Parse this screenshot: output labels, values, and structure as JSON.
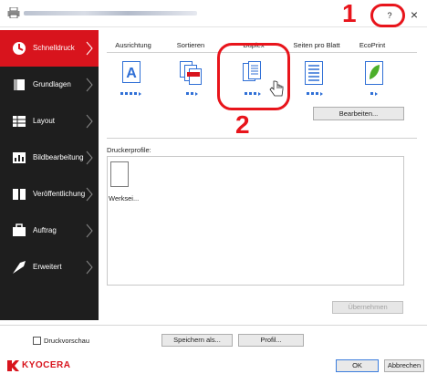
{
  "titlebar": {
    "help_label": "?",
    "close_label": "×"
  },
  "annotations": {
    "marker_1": "1",
    "marker_2": "2"
  },
  "sidebar": {
    "items": [
      {
        "label": "Schnelldruck",
        "icon": "quick-print-icon",
        "active": true
      },
      {
        "label": "Grundlagen",
        "icon": "basics-icon",
        "active": false
      },
      {
        "label": "Layout",
        "icon": "layout-icon",
        "active": false
      },
      {
        "label": "Bildbearbeitung",
        "icon": "image-edit-icon",
        "active": false
      },
      {
        "label": "Veröffentlichung",
        "icon": "publishing-icon",
        "active": false
      },
      {
        "label": "Auftrag",
        "icon": "job-icon",
        "active": false
      },
      {
        "label": "Erweitert",
        "icon": "advanced-icon",
        "active": false
      }
    ]
  },
  "tabs": [
    {
      "label": "Ausrichtung",
      "icon": "orientation-icon"
    },
    {
      "label": "Sortieren",
      "icon": "collate-icon"
    },
    {
      "label": "Duplex",
      "icon": "duplex-icon"
    },
    {
      "label": "Seiten pro Blatt",
      "icon": "pages-per-sheet-icon"
    },
    {
      "label": "EcoPrint",
      "icon": "ecoprint-icon"
    }
  ],
  "main": {
    "edit_button": "Bearbeiten...",
    "profiles_label": "Druckerprofile:",
    "profile_item_name": "Werksei...",
    "apply_button": "Übernehmen"
  },
  "footer": {
    "preview_label": "Druckvorschau",
    "save_as_button": "Speichern als...",
    "profile_button": "Profil...",
    "ok_button": "OK",
    "cancel_button": "Abbrechen",
    "brand": "KYOCERA"
  },
  "colors": {
    "accent_red": "#d8141d",
    "sidebar_bg": "#1e1e1e",
    "highlight_blue": "#2f6fd6",
    "annotation_red": "#e8141b"
  }
}
